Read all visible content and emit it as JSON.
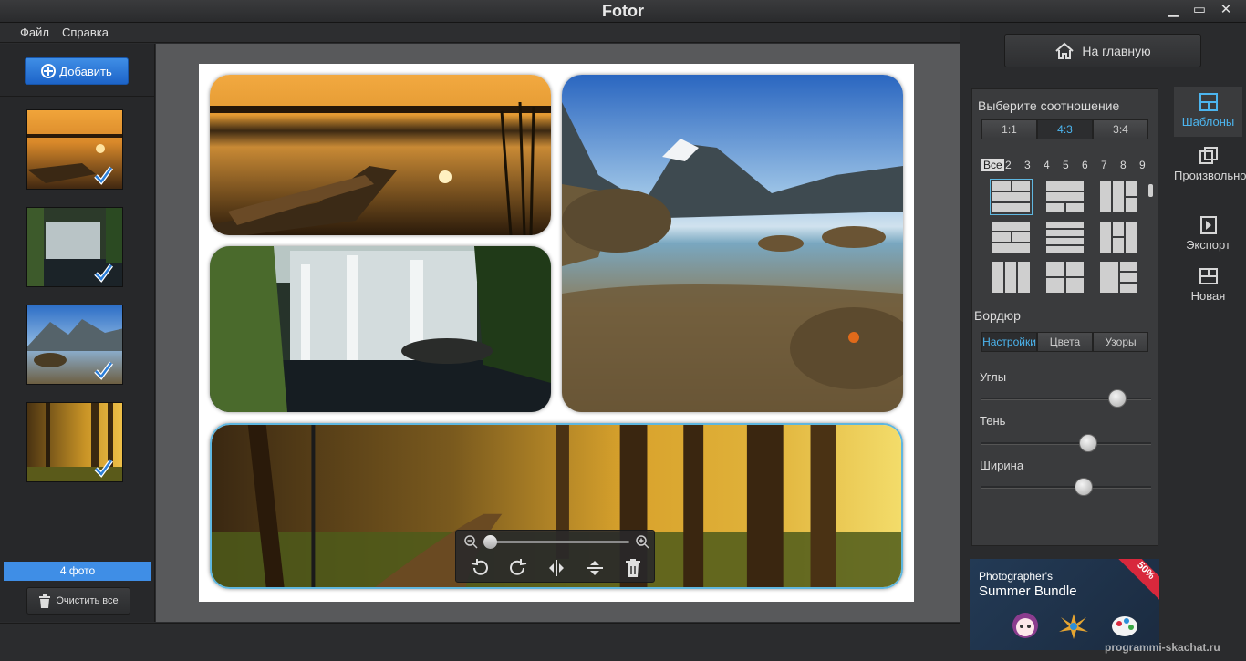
{
  "window": {
    "title": "Fotor",
    "min_glyph": "▁",
    "max_glyph": "▭",
    "close_glyph": "✕"
  },
  "menu": {
    "file": "Файл",
    "help": "Справка"
  },
  "left": {
    "add_label": "Добавить",
    "photo_count": "4 фото",
    "clear_label": "Очистить все"
  },
  "right": {
    "home_label": "На главную",
    "ratio_title": "Выберите соотношение",
    "ratios": [
      "1:1",
      "4:3",
      "3:4"
    ],
    "ratio_selected": "4:3",
    "counts": [
      "Все",
      "2",
      "3",
      "4",
      "5",
      "6",
      "7",
      "8",
      "9"
    ],
    "border_title": "Бордюр",
    "border_tabs": [
      "Настройки",
      "Цвета",
      "Узоры"
    ],
    "sliders": [
      {
        "label": "Углы",
        "value": 0.8
      },
      {
        "label": "Тень",
        "value": 0.63
      },
      {
        "label": "Ширина",
        "value": 0.6
      }
    ],
    "nav": [
      "Шаблоны",
      "Произвольно",
      "Экспорт",
      "Новая"
    ],
    "nav_active": "Шаблоны",
    "ad": {
      "line1": "Photographer's",
      "line2": "Summer Bundle",
      "badge": "50%"
    }
  },
  "watermark": "programmi-skachat.ru",
  "colors": {
    "accent": "#3f8ee6",
    "highlight": "#4cb5ef",
    "selection": "#5fb7e0"
  }
}
